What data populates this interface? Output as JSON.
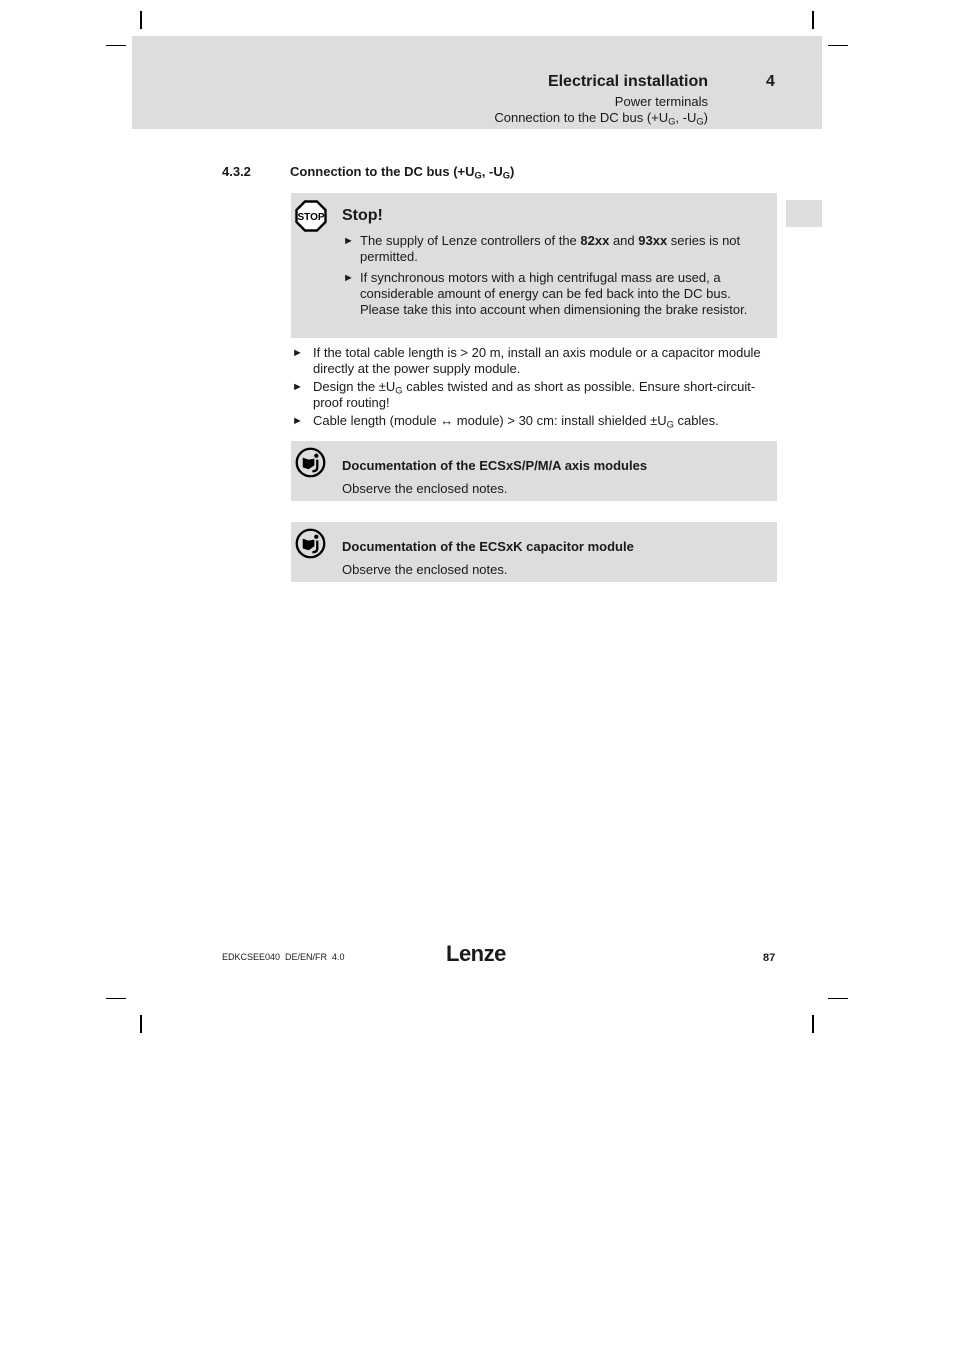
{
  "header": {
    "title": "Electrical installation",
    "chapter": "4",
    "subtitle": "Power terminals",
    "breadcrumb_prefix": "Connection to the DC bus (+U",
    "breadcrumb_sub1": "G",
    "breadcrumb_mid": ", -U",
    "breadcrumb_sub2": "G",
    "breadcrumb_suffix": ")"
  },
  "section": {
    "number": "4.3.2",
    "title_prefix": "Connection to the DC bus (+U",
    "title_sub1": "G",
    "title_mid": ", -U",
    "title_sub2": "G",
    "title_suffix": ")"
  },
  "stop_box": {
    "icon": "stop-sign-icon",
    "icon_text": "STOP",
    "heading": "Stop!",
    "bullet_glyph": "►",
    "items": [
      {
        "part1": "The supply of Lenze controllers of the ",
        "bold1": "82xx",
        "part2": " and ",
        "bold2": "93xx",
        "part3": " series is not permitted."
      },
      {
        "text": "If synchronous motors with a high centrifugal mass are used, a considerable amount of energy can be fed back into the DC bus. Please take this into account when dimensioning the brake resistor."
      }
    ]
  },
  "bullets": {
    "glyph": "►",
    "item1": "If the total cable length is > 20 m, install an axis module or a capacitor module directly at the power supply module.",
    "item2_prefix": "Design the ±U",
    "item2_sub": "G",
    "item2_suffix": " cables twisted and as short as possible. Ensure short-circuit-proof routing!",
    "item3_prefix": "Cable length (module ↔ module) > 30 cm: install shielded ±U",
    "item3_sub": "G",
    "item3_suffix": " cables."
  },
  "notes": [
    {
      "icon": "documentation-hint-icon",
      "title": "Documentation of the ECSxS/P/M/A axis modules",
      "text": "Observe the enclosed notes."
    },
    {
      "icon": "documentation-hint-icon",
      "title": "Documentation of the ECSxK capacitor module",
      "text": "Observe the enclosed notes."
    }
  ],
  "footer": {
    "doc_id": "EDKCSEE040  DE/EN/FR  4.0",
    "logo": "Lenze",
    "page_number": "87"
  },
  "colors": {
    "panel_gray": "#dddddd",
    "text": "#1a1a1a"
  }
}
